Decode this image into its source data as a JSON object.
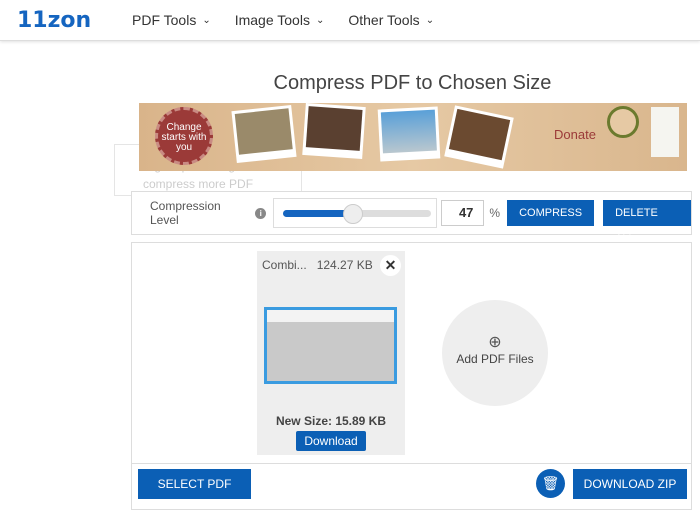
{
  "nav": {
    "logo": "11zon",
    "menus": [
      "PDF Tools",
      "Image Tools",
      "Other Tools"
    ]
  },
  "page_title": "Compress PDF to Chosen Size",
  "banner": {
    "seal_text": "Change starts with you",
    "donate": "Donate"
  },
  "tooltip": "Higher percentage will compress more PDF size.",
  "controls": {
    "label": "Compression Level",
    "value": "47",
    "slider_percent": 47,
    "unit": "%",
    "compress": "COMPRESS",
    "delete_all": "DELETE ALL"
  },
  "file": {
    "name": "Combi...",
    "size": "124.27 KB",
    "new_size": "New Size: 15.89 KB",
    "download": "Download"
  },
  "add_files": "Add PDF Files",
  "footer": {
    "select": "SELECT PDF",
    "download_zip": "DOWNLOAD ZIP"
  },
  "colors": {
    "accent": "#0b5fb5"
  }
}
